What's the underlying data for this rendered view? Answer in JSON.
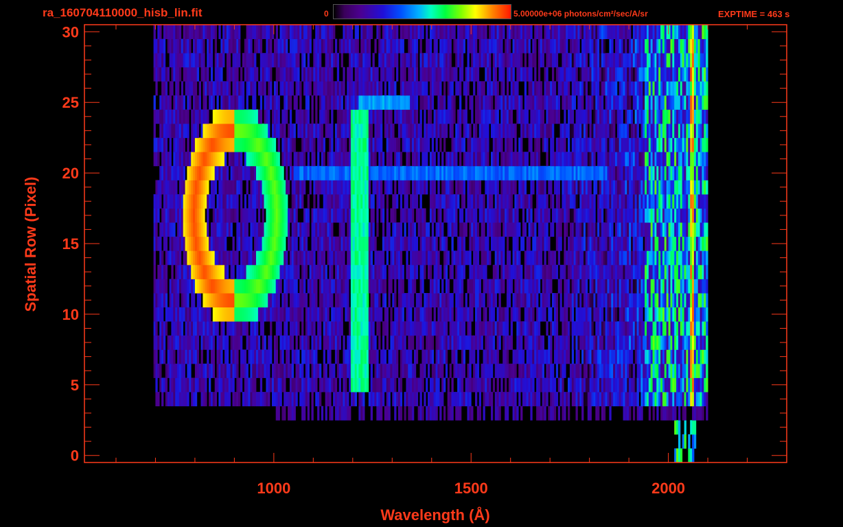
{
  "header": {
    "file_title": "ra_160704110000_hisb_lin.fit",
    "colorbar_min": "0",
    "colorbar_max": "5.00000e+06 photons/cm²/sec/A/sr",
    "exptime": "EXPTIME = 463 s"
  },
  "colors": {
    "axis": "#ff3a1a",
    "background": "#000000"
  },
  "chart_data": {
    "type": "heatmap",
    "title": "ra_160704110000_hisb_lin.fit",
    "xlabel": "Wavelength (Å)",
    "ylabel": "Spatial Row (Pixel)",
    "xlim": [
      520,
      2300
    ],
    "ylim": [
      -0.5,
      30.5
    ],
    "x_ticks": [
      1000,
      1500,
      2000
    ],
    "y_ticks": [
      0,
      5,
      10,
      15,
      20,
      25,
      30
    ],
    "colorbar": {
      "min": 0,
      "max": 5000000,
      "units": "photons/cm²/sec/A/sr"
    },
    "features": [
      {
        "name": "vertical emission line",
        "x": 1215,
        "row_range": [
          5,
          24
        ]
      },
      {
        "name": "horizontal band",
        "row": 20,
        "x_range": [
          1050,
          1840
        ]
      },
      {
        "name": "short band",
        "row": 25,
        "x_range": [
          1215,
          1340
        ]
      },
      {
        "name": "ring feature",
        "x_center": 900,
        "row_center": 17,
        "x_halfwidth": 105,
        "row_halfwidth": 6
      },
      {
        "name": "detector red edge",
        "x_range": [
          1940,
          2100
        ]
      }
    ]
  }
}
